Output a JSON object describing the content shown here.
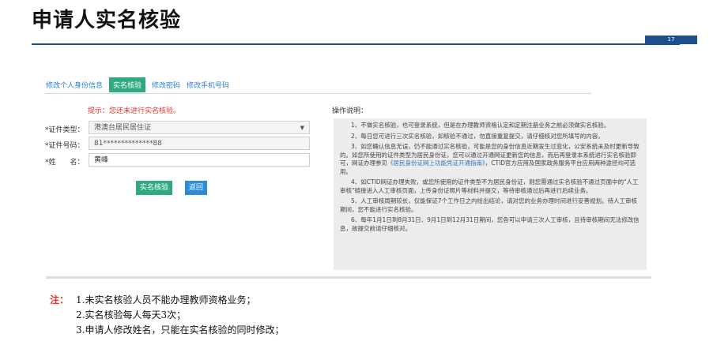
{
  "slide": {
    "title": "申请人实名核验",
    "page_number": "17"
  },
  "tabs": [
    {
      "label": "修改个人身份信息"
    },
    {
      "label": "实名核验"
    },
    {
      "label": "修改密码"
    },
    {
      "label": "修改手机号码"
    }
  ],
  "form": {
    "hint": "提示：您还未进行实名核验。",
    "id_type": {
      "label": "*证件类型：",
      "value": "港澳台居民居住证"
    },
    "id_number": {
      "label": "*证件号码：",
      "value": "81**************88"
    },
    "name": {
      "label": "*姓　　名：",
      "value": "黄峰"
    },
    "verify_button": "实名核验",
    "back_button": "返回"
  },
  "instructions": {
    "title": "操作说明：",
    "items": [
      "1、不做实名核验，也可登录系统，但是在办理教师资格认定和定期注册业务之前必须做实名核验。",
      "2、每日您可进行三次实名核验，如核验不通过，勿直接重复提交，请仔细核对您所填写的内容。",
      "3、如您确认信息无误，仍不能通过实名核验，可能是您的身份信息近期发生过变化，公安系统未及时更新导致的。如您所使用的证件类型为居民身份证，您可以通过开通网证更新您的信息，而后再登录本系统进行实名核验即可，网证办理参见",
      "《居民身份证网上功能凭证开通指南》",
      "，CTID官方应用及国家政务服务平台应用两种途径均可选用。",
      "4、如CTID网证办理失败，或您所使用的证件类型不为居民身份证，则您需通过实名核验不通过页面中的\"人工审核\"链接进入人工审核页面，上传身份证照片等材料并提交，等待审核通过后再进行后续业务。",
      "5、人工审核周期较长，仅能保证7个工作日之内给出结论，请对您的业务办理时间进行妥善规划。待人工审核期间，您不能进行实名核验。",
      "6、每年1月1日到8月31日、9月1日到12月31日期间，您各可以申请三次人工审核，且待审核期间无法修改信息，故提交前请仔细核对。"
    ]
  },
  "note": {
    "head": "注：",
    "lines": [
      "1.未实名核验人员不能办理教师资格业务；",
      "2.实名核验每人每天3次；",
      "3.申请人修改姓名，只能在实名核验的同时修改；"
    ]
  }
}
